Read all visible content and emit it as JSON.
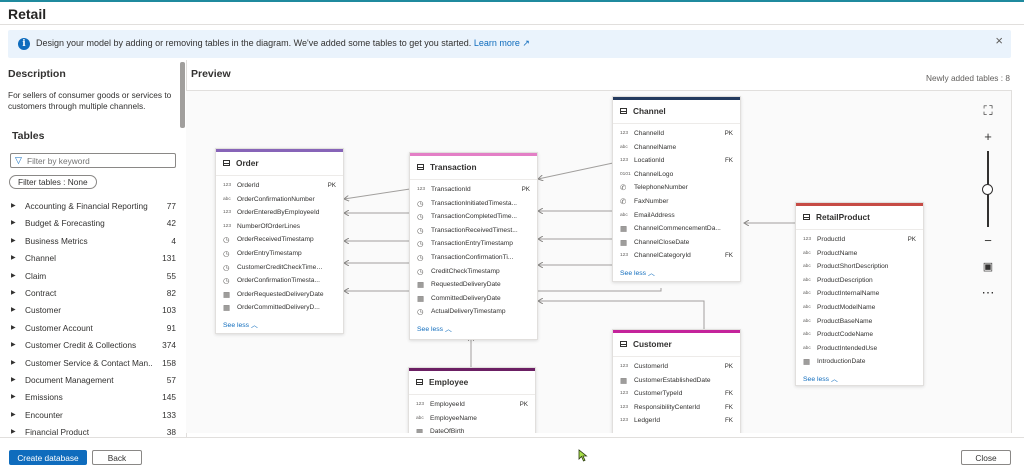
{
  "window": {
    "title": "Retail"
  },
  "banner": {
    "message": "Design your model by adding or removing tables in the diagram. We've added some tables to get you started.",
    "link": "Learn more"
  },
  "left": {
    "description_heading": "Description",
    "description": "For sellers of consumer goods or services to customers through multiple channels.",
    "tables_heading": "Tables",
    "filter_placeholder": "Filter by keyword",
    "filter_pill": "Filter tables : None",
    "tables": [
      {
        "name": "Accounting & Financial Reporting",
        "count": "77"
      },
      {
        "name": "Budget & Forecasting",
        "count": "42"
      },
      {
        "name": "Business Metrics",
        "count": "4"
      },
      {
        "name": "Channel",
        "count": "131"
      },
      {
        "name": "Claim",
        "count": "55"
      },
      {
        "name": "Contract",
        "count": "82"
      },
      {
        "name": "Customer",
        "count": "103"
      },
      {
        "name": "Customer Account",
        "count": "91"
      },
      {
        "name": "Customer Credit & Collections",
        "count": "374"
      },
      {
        "name": "Customer Service & Contact Man...",
        "count": "158"
      },
      {
        "name": "Document Management",
        "count": "57"
      },
      {
        "name": "Emissions",
        "count": "145"
      },
      {
        "name": "Encounter",
        "count": "133"
      },
      {
        "name": "Financial Product",
        "count": "38"
      }
    ]
  },
  "preview": {
    "heading": "Preview",
    "newly_added": "Newly added tables : 8",
    "see_less": "See less",
    "tables": {
      "order": {
        "name": "Order",
        "color": "#8764b8",
        "fields": [
          {
            "type": "123",
            "name": "OrderId",
            "key": "PK"
          },
          {
            "type": "abc",
            "name": "OrderConfirmationNumber",
            "key": ""
          },
          {
            "type": "123",
            "name": "OrderEnteredByEmployeeId",
            "key": ""
          },
          {
            "type": "123",
            "name": "NumberOfOrderLines",
            "key": ""
          },
          {
            "type": "clock",
            "name": "OrderReceivedTimestamp",
            "key": ""
          },
          {
            "type": "clock",
            "name": "OrderEntryTimestamp",
            "key": ""
          },
          {
            "type": "clock",
            "name": "CustomerCreditCheckTimes...",
            "key": ""
          },
          {
            "type": "clock",
            "name": "OrderConfirmationTimesta...",
            "key": ""
          },
          {
            "type": "cal",
            "name": "OrderRequestedDeliveryDate",
            "key": ""
          },
          {
            "type": "cal",
            "name": "OrderCommittedDeliveryD...",
            "key": ""
          }
        ]
      },
      "transaction": {
        "name": "Transaction",
        "color": "#e37fc6",
        "fields": [
          {
            "type": "123",
            "name": "TransactionId",
            "key": "PK"
          },
          {
            "type": "clock",
            "name": "TransactionInitiatedTimesta...",
            "key": ""
          },
          {
            "type": "clock",
            "name": "TransactionCompletedTime...",
            "key": ""
          },
          {
            "type": "clock",
            "name": "TransactionReceivedTimest...",
            "key": ""
          },
          {
            "type": "clock",
            "name": "TransactionEntryTimestamp",
            "key": ""
          },
          {
            "type": "clock",
            "name": "TransactionConfirmationTi...",
            "key": ""
          },
          {
            "type": "clock",
            "name": "CreditCheckTimestamp",
            "key": ""
          },
          {
            "type": "cal",
            "name": "RequestedDeliveryDate",
            "key": ""
          },
          {
            "type": "cal",
            "name": "CommittedDeliveryDate",
            "key": ""
          },
          {
            "type": "clock",
            "name": "ActualDeliveryTimestamp",
            "key": ""
          }
        ]
      },
      "channel": {
        "name": "Channel",
        "color": "#243a5e",
        "fields": [
          {
            "type": "123",
            "name": "ChannelId",
            "key": "PK"
          },
          {
            "type": "abc",
            "name": "ChannelName",
            "key": ""
          },
          {
            "type": "123",
            "name": "LocationId",
            "key": "FK"
          },
          {
            "type": "bin",
            "name": "ChannelLogo",
            "key": ""
          },
          {
            "type": "tel",
            "name": "TelephoneNumber",
            "key": ""
          },
          {
            "type": "tel",
            "name": "FaxNumber",
            "key": ""
          },
          {
            "type": "abc",
            "name": "EmailAddress",
            "key": ""
          },
          {
            "type": "cal",
            "name": "ChannelCommencementDa...",
            "key": ""
          },
          {
            "type": "cal",
            "name": "ChannelCloseDate",
            "key": ""
          },
          {
            "type": "123",
            "name": "ChannelCategoryId",
            "key": "FK"
          }
        ]
      },
      "retailproduct": {
        "name": "RetailProduct",
        "color": "#c64b45",
        "fields": [
          {
            "type": "123",
            "name": "ProductId",
            "key": "PK"
          },
          {
            "type": "abc",
            "name": "ProductName",
            "key": ""
          },
          {
            "type": "abc",
            "name": "ProductShortDescription",
            "key": ""
          },
          {
            "type": "abc",
            "name": "ProductDescription",
            "key": ""
          },
          {
            "type": "abc",
            "name": "ProductInternalName",
            "key": ""
          },
          {
            "type": "abc",
            "name": "ProductModelName",
            "key": ""
          },
          {
            "type": "abc",
            "name": "ProductBaseName",
            "key": ""
          },
          {
            "type": "abc",
            "name": "ProductCodeName",
            "key": ""
          },
          {
            "type": "abc",
            "name": "ProductIntendedUse",
            "key": ""
          },
          {
            "type": "cal",
            "name": "IntroductionDate",
            "key": ""
          }
        ]
      },
      "customer": {
        "name": "Customer",
        "color": "#c4239b",
        "fields": [
          {
            "type": "123",
            "name": "CustomerId",
            "key": "PK"
          },
          {
            "type": "cal",
            "name": "CustomerEstablishedDate",
            "key": ""
          },
          {
            "type": "123",
            "name": "CustomerTypeId",
            "key": "FK"
          },
          {
            "type": "123",
            "name": "ResponsibilityCenterId",
            "key": "FK"
          },
          {
            "type": "123",
            "name": "LedgerId",
            "key": "FK"
          }
        ]
      },
      "employee": {
        "name": "Employee",
        "color": "#6b1f63",
        "fields": [
          {
            "type": "123",
            "name": "EmployeeId",
            "key": "PK"
          },
          {
            "type": "abc",
            "name": "EmployeeName",
            "key": ""
          },
          {
            "type": "cal",
            "name": "DateOfBirth",
            "key": ""
          }
        ]
      }
    }
  },
  "footer": {
    "create_label": "Create database",
    "back_label": "Back",
    "close_label": "Close"
  }
}
